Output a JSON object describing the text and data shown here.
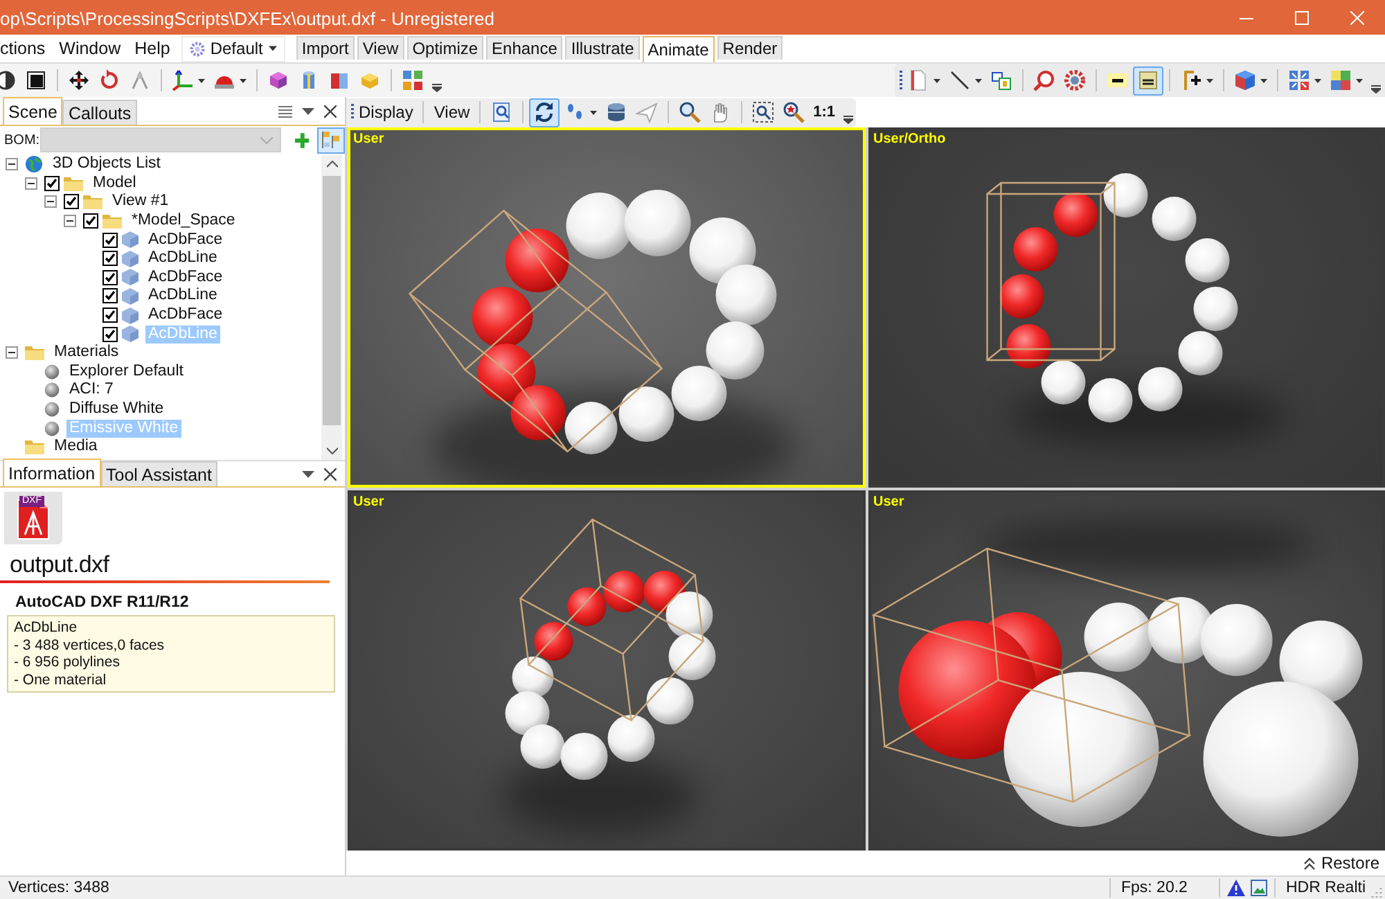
{
  "window": {
    "title": "op\\Scripts\\ProcessingScripts\\DXFEx\\output.dxf - Unregistered"
  },
  "menu": {
    "items": [
      "ctions",
      "Window",
      "Help"
    ],
    "workspace": "Default"
  },
  "ribbon_tabs": [
    {
      "label": "Import",
      "selected": false
    },
    {
      "label": "View",
      "selected": false
    },
    {
      "label": "Optimize",
      "selected": false
    },
    {
      "label": "Enhance",
      "selected": false
    },
    {
      "label": "Illustrate",
      "selected": false
    },
    {
      "label": "Animate",
      "selected": true
    },
    {
      "label": "Render",
      "selected": false
    }
  ],
  "main_toolbar": {
    "groups_left": [
      [
        {
          "kind": "shading",
          "pressed": false,
          "dropdown": false
        },
        {
          "kind": "display-mode",
          "pressed": false,
          "dropdown": false
        }
      ],
      [
        {
          "kind": "move",
          "pressed": false,
          "dropdown": false
        },
        {
          "kind": "rotate",
          "pressed": false,
          "dropdown": false
        },
        {
          "kind": "compass",
          "pressed": false,
          "dropdown": false
        }
      ],
      [
        {
          "kind": "axes",
          "pressed": false,
          "dropdown": true
        },
        {
          "kind": "helmet",
          "pressed": false,
          "dropdown": true
        }
      ],
      [
        {
          "kind": "cube-pink",
          "pressed": false,
          "dropdown": false
        },
        {
          "kind": "cylinder",
          "pressed": false,
          "dropdown": false
        },
        {
          "kind": "box-cut",
          "pressed": false,
          "dropdown": false
        },
        {
          "kind": "cube-yellow",
          "pressed": false,
          "dropdown": false
        }
      ],
      [
        {
          "kind": "grid-colors",
          "pressed": false,
          "dropdown": false
        }
      ]
    ],
    "groups_right": [
      [
        {
          "kind": "page",
          "pressed": false,
          "dropdown": true
        },
        {
          "kind": "line",
          "pressed": false,
          "dropdown": true
        },
        {
          "kind": "boxes",
          "pressed": false,
          "dropdown": false
        }
      ],
      [
        {
          "kind": "zoom-red",
          "pressed": false,
          "dropdown": false
        },
        {
          "kind": "gear-red",
          "pressed": false,
          "dropdown": false
        }
      ],
      [
        {
          "kind": "minus",
          "pressed": false,
          "dropdown": false
        },
        {
          "kind": "card",
          "pressed": true,
          "dropdown": false
        }
      ],
      [
        {
          "kind": "axis-plus",
          "pressed": false,
          "dropdown": true
        }
      ],
      [
        {
          "kind": "cube-blue",
          "pressed": false,
          "dropdown": true
        }
      ],
      [
        {
          "kind": "grid-arrows",
          "pressed": false,
          "dropdown": true
        },
        {
          "kind": "color-squares",
          "pressed": false,
          "dropdown": true
        }
      ]
    ]
  },
  "viewport_toolbar": {
    "menus": [
      "Display",
      "View"
    ],
    "groups": [
      [
        {
          "kind": "zoom-page",
          "pressed": false,
          "dropdown": false
        }
      ],
      [
        {
          "kind": "orbit",
          "pressed": true,
          "dropdown": false
        },
        {
          "kind": "footprints",
          "pressed": false,
          "dropdown": true
        },
        {
          "kind": "barrel",
          "pressed": false,
          "dropdown": false
        },
        {
          "kind": "plane",
          "pressed": false,
          "dropdown": false
        }
      ],
      [
        {
          "kind": "magnifier",
          "pressed": false,
          "dropdown": false
        },
        {
          "kind": "hand",
          "pressed": false,
          "dropdown": false
        }
      ],
      [
        {
          "kind": "zoom-extents",
          "pressed": false,
          "dropdown": false
        },
        {
          "kind": "magnifier-star",
          "pressed": false,
          "dropdown": false
        }
      ]
    ],
    "scale_button": "1:1"
  },
  "scene_panel": {
    "tabs": [
      {
        "label": "Scene",
        "selected": true
      },
      {
        "label": "Callouts",
        "selected": false
      }
    ],
    "bom": {
      "label": "BOM:",
      "disabled": true,
      "toggle_pressed": true
    },
    "tree": [
      {
        "label": "3D Objects List",
        "kind": "globe",
        "expanded": true,
        "selected": false,
        "children": [
          {
            "label": "Model",
            "kind": "folder",
            "expanded": true,
            "checked": true,
            "selected": false,
            "children": [
              {
                "label": "View #1",
                "kind": "folder",
                "expanded": true,
                "checked": true,
                "selected": false,
                "children": [
                  {
                    "label": "*Model_Space",
                    "kind": "folder",
                    "expanded": true,
                    "checked": true,
                    "selected": false,
                    "children": [
                      {
                        "label": "AcDbFace",
                        "kind": "object",
                        "checked": true,
                        "selected": false
                      },
                      {
                        "label": "AcDbLine",
                        "kind": "object",
                        "checked": true,
                        "selected": false
                      },
                      {
                        "label": "AcDbFace",
                        "kind": "object",
                        "checked": true,
                        "selected": false
                      },
                      {
                        "label": "AcDbLine",
                        "kind": "object",
                        "checked": true,
                        "selected": false
                      },
                      {
                        "label": "AcDbFace",
                        "kind": "object",
                        "checked": true,
                        "selected": false
                      },
                      {
                        "label": "AcDbLine",
                        "kind": "object",
                        "checked": true,
                        "selected": true
                      }
                    ]
                  }
                ]
              }
            ]
          }
        ]
      },
      {
        "label": "Materials",
        "kind": "folder",
        "expanded": true,
        "selected": false,
        "children": [
          {
            "label": "Explorer Default",
            "kind": "material",
            "selected": false
          },
          {
            "label": "ACI: 7",
            "kind": "material",
            "selected": false
          },
          {
            "label": "Diffuse White",
            "kind": "material",
            "selected": false
          },
          {
            "label": "Emissive White",
            "kind": "material",
            "selected": true
          }
        ]
      },
      {
        "label": "Media",
        "kind": "folder",
        "selected": false
      }
    ]
  },
  "information_panel": {
    "tabs": [
      {
        "label": "Information",
        "selected": true
      },
      {
        "label": "Tool Assistant",
        "selected": false
      }
    ],
    "file_badge": "DXF",
    "file_name": "output.dxf",
    "format": "AutoCAD DXF R11/R12",
    "details": [
      "AcDbLine",
      "- 3 488 vertices,0 faces",
      "- 6 956 polylines",
      "- One material"
    ]
  },
  "viewports": [
    {
      "label": "User",
      "selected": true
    },
    {
      "label": "User/Ortho",
      "selected": false
    },
    {
      "label": "User",
      "selected": false
    },
    {
      "label": "User",
      "selected": false
    }
  ],
  "restore_button": "Restore",
  "status_bar": {
    "vertices": "Vertices: 3488",
    "fps": "Fps: 20.2",
    "renderer": "HDR Realti"
  }
}
